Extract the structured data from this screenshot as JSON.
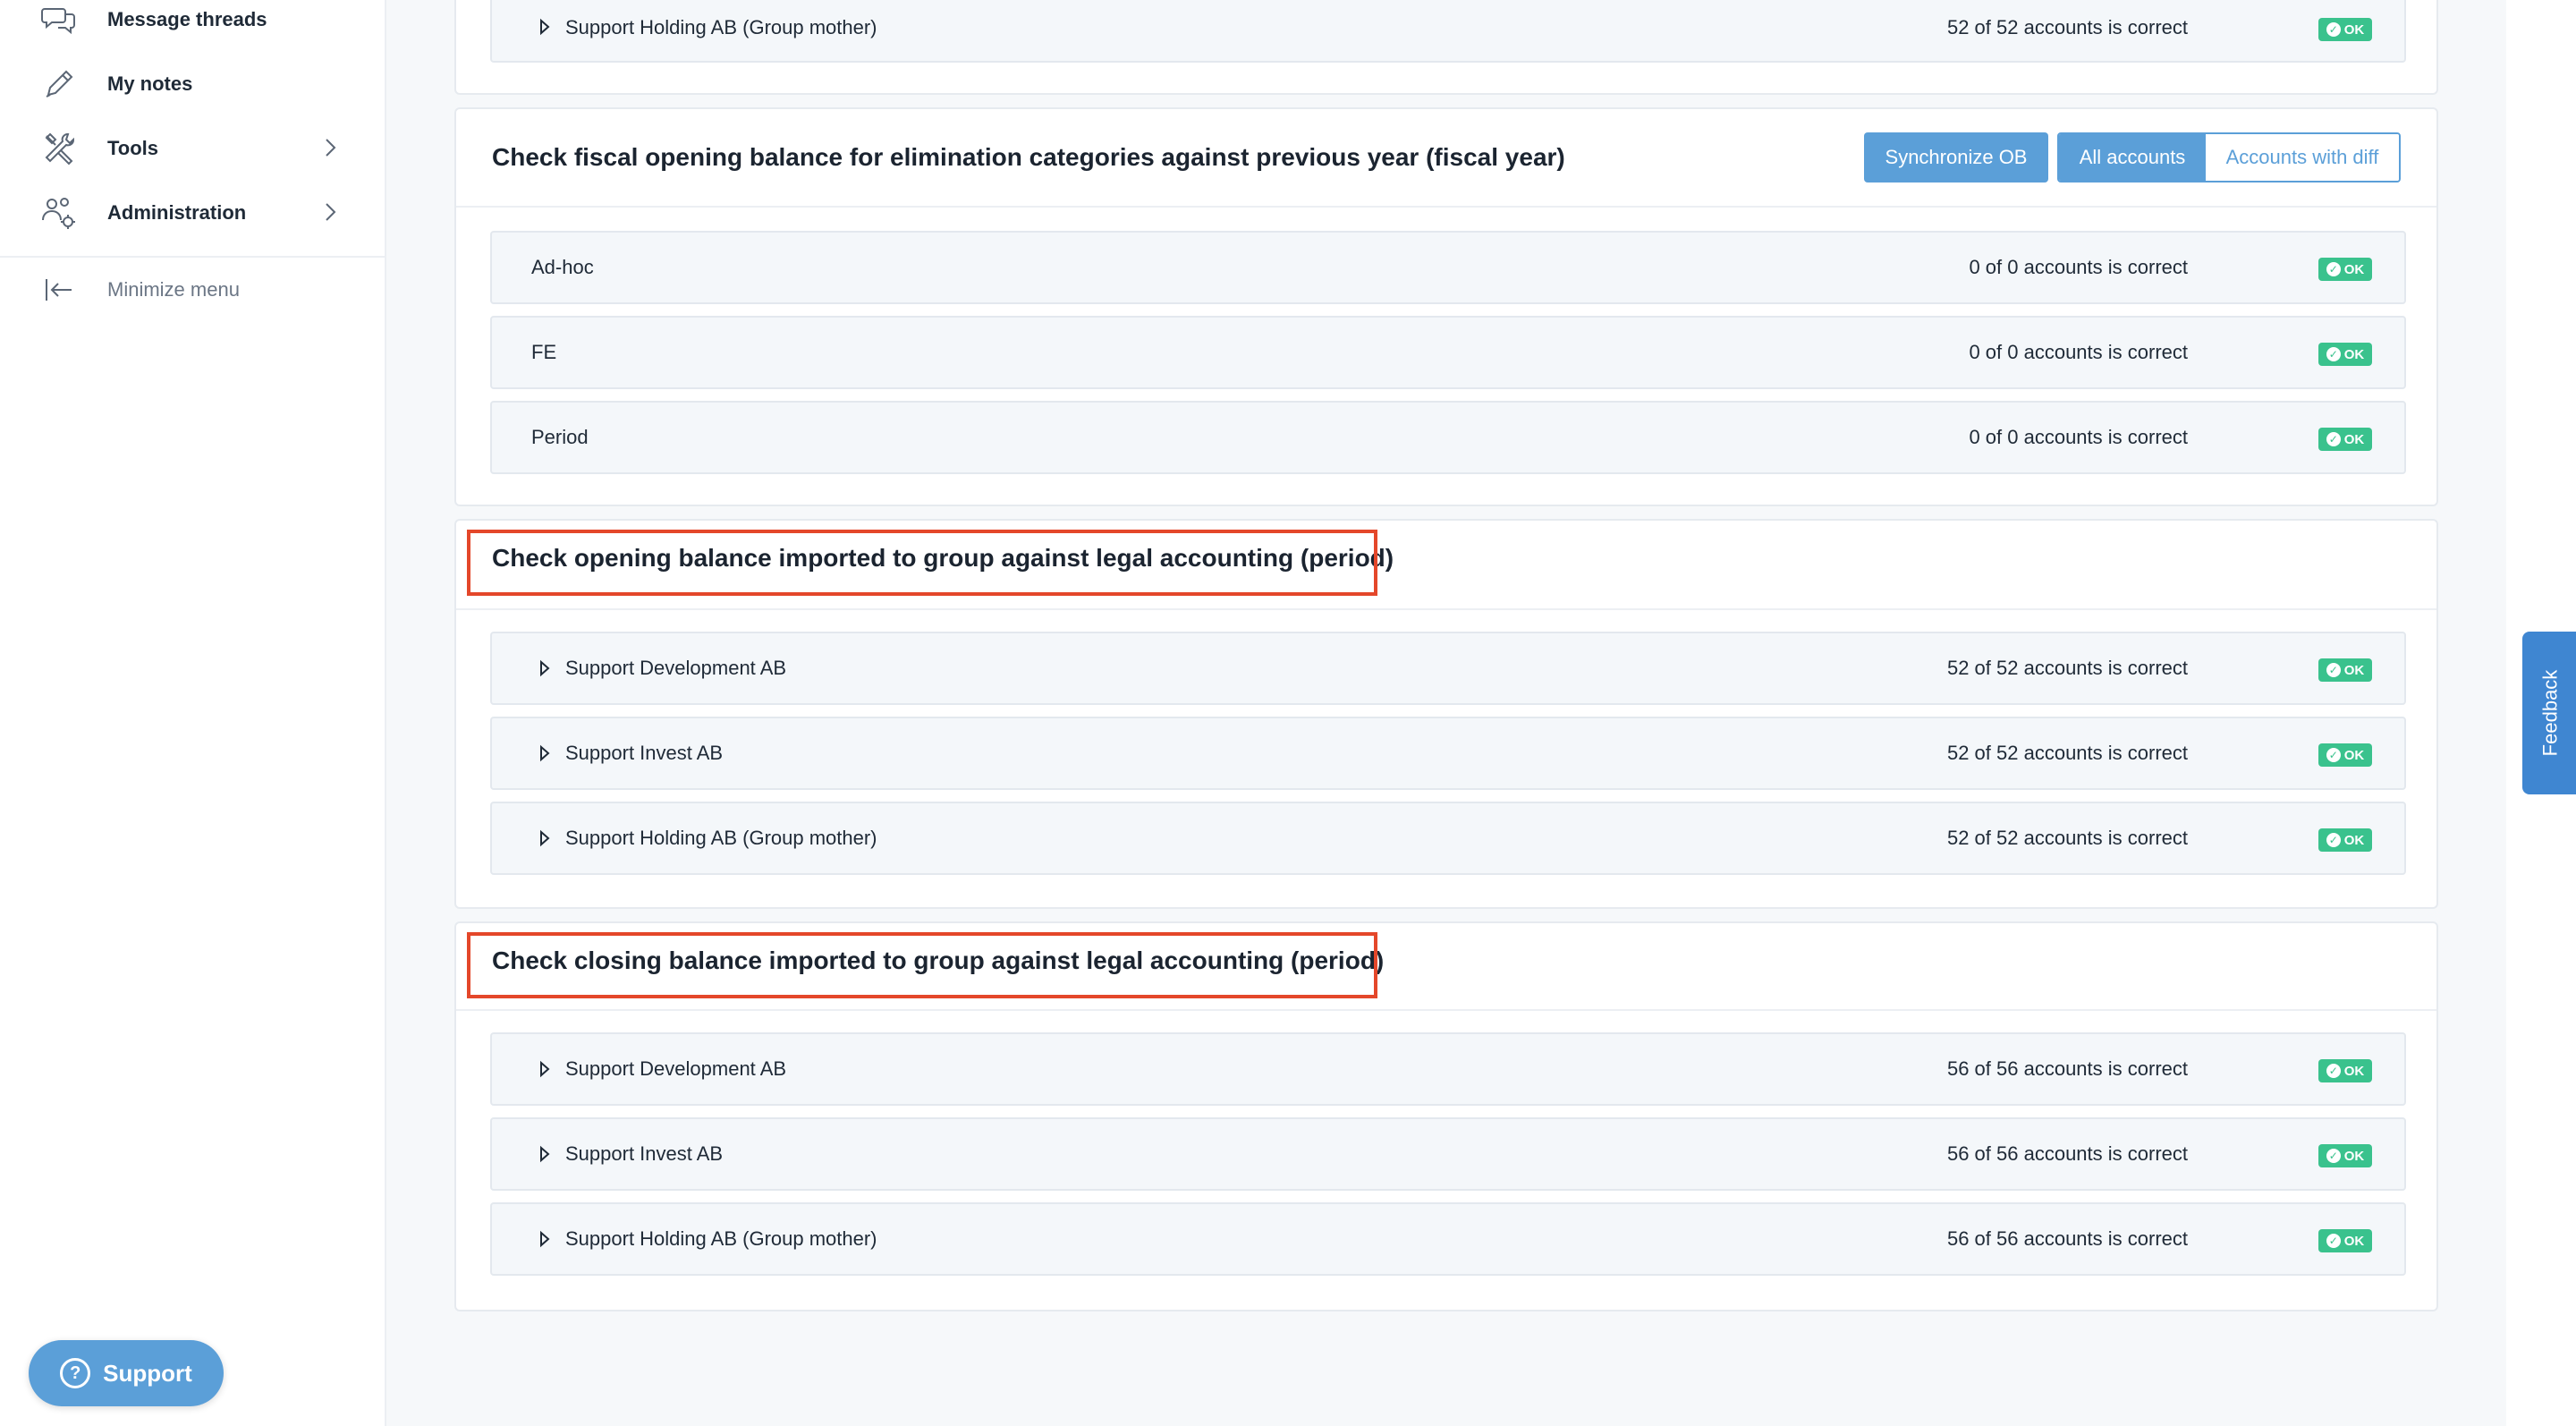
{
  "sidebar": {
    "items": [
      {
        "label": "Message threads",
        "icon": "chat-bubbles-icon"
      },
      {
        "label": "My notes",
        "icon": "pencil-icon"
      },
      {
        "label": "Tools",
        "icon": "tools-icon",
        "has_submenu": true
      },
      {
        "label": "Administration",
        "icon": "users-gear-icon",
        "has_submenu": true
      }
    ],
    "minimize_label": "Minimize menu",
    "support_label": "Support"
  },
  "top_card": {
    "row": {
      "name": "Support Holding AB (Group mother)",
      "status": "52 of 52 accounts is correct",
      "badge": "OK"
    }
  },
  "fiscal_card": {
    "title": "Check fiscal opening balance for elimination categories against previous year (fiscal year)",
    "sync_button": "Synchronize OB",
    "filter_all": "All accounts",
    "filter_diff": "Accounts with diff",
    "rows": [
      {
        "name": "Ad-hoc",
        "status": "0 of 0 accounts is correct",
        "badge": "OK"
      },
      {
        "name": "FE",
        "status": "0 of 0 accounts is correct",
        "badge": "OK"
      },
      {
        "name": "Period",
        "status": "0 of 0 accounts is correct",
        "badge": "OK"
      }
    ]
  },
  "opening_card": {
    "title": "Check opening balance imported to group against legal accounting (period)",
    "rows": [
      {
        "name": "Support Development AB",
        "status": "52 of 52 accounts is correct",
        "badge": "OK"
      },
      {
        "name": "Support Invest AB",
        "status": "52 of 52 accounts is correct",
        "badge": "OK"
      },
      {
        "name": "Support Holding AB (Group mother)",
        "status": "52 of 52 accounts is correct",
        "badge": "OK"
      }
    ]
  },
  "closing_card": {
    "title": "Check closing balance imported to group against legal accounting (period)",
    "rows": [
      {
        "name": "Support Development AB",
        "status": "56 of 56 accounts is correct",
        "badge": "OK"
      },
      {
        "name": "Support Invest AB",
        "status": "56 of 56 accounts is correct",
        "badge": "OK"
      },
      {
        "name": "Support Holding AB (Group mother)",
        "status": "56 of 56 accounts is correct",
        "badge": "OK"
      }
    ]
  },
  "feedback_label": "Feedback",
  "colors": {
    "accent": "#5b9fd8",
    "ok_green": "#3ac28d",
    "highlight_red": "#e4472a",
    "feedback_blue": "#3f86d1"
  }
}
